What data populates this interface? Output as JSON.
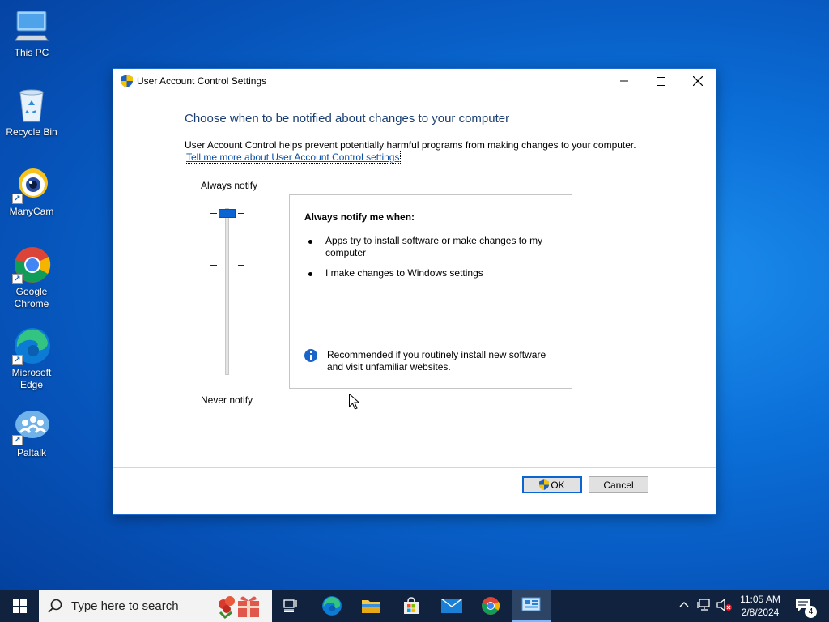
{
  "desktop": {
    "icons": [
      {
        "label": "This PC"
      },
      {
        "label": "Recycle Bin"
      },
      {
        "label": "ManyCam"
      },
      {
        "label": "Google Chrome"
      },
      {
        "label": "Microsoft Edge"
      },
      {
        "label": "Paltalk"
      }
    ]
  },
  "dialog": {
    "title": "User Account Control Settings",
    "heading": "Choose when to be notified about changes to your computer",
    "description": "User Account Control helps prevent potentially harmful programs from making changes to your computer.",
    "link": "Tell me more about User Account Control settings",
    "slider": {
      "top_label": "Always notify",
      "bottom_label": "Never notify",
      "levels": 4,
      "selected_level": 1
    },
    "info": {
      "heading": "Always notify me when:",
      "items": [
        "Apps try to install software or make changes to my computer",
        "I make changes to Windows settings"
      ],
      "note": "Recommended if you routinely install new software and visit unfamiliar websites."
    },
    "buttons": {
      "ok": "OK",
      "cancel": "Cancel"
    }
  },
  "taskbar": {
    "search_placeholder": "Type here to search",
    "clock_time": "11:05 AM",
    "clock_date": "2/8/2024",
    "notification_count": "4"
  },
  "colors": {
    "accent": "#0a64d2",
    "heading": "#1a3e72",
    "taskbar": "#10223d"
  }
}
